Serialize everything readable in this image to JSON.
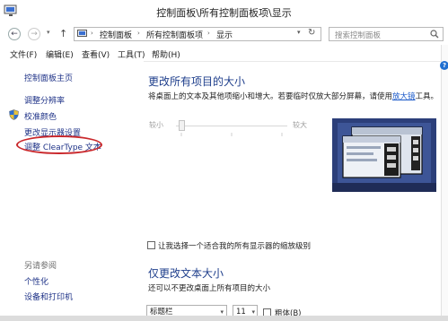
{
  "window": {
    "title": "控制面板\\所有控制面板项\\显示",
    "controls": {
      "minimize": "—",
      "maximize": "☐",
      "close": "✕"
    }
  },
  "nav": {
    "back": "←",
    "forward": "→",
    "up": "↑",
    "breadcrumbs": [
      "控制面板",
      "所有控制面板项",
      "显示"
    ],
    "separator": "›",
    "refresh": "↻",
    "search_placeholder": "搜索控制面板"
  },
  "menu": {
    "items": [
      "文件(F)",
      "编辑(E)",
      "查看(V)",
      "工具(T)",
      "帮助(H)"
    ]
  },
  "sidebar": {
    "home": "控制面板主页",
    "links": [
      "调整分辨率",
      "校准颜色",
      "更改显示器设置",
      "调整 ClearType 文本"
    ],
    "see_also_title": "另请参阅",
    "see_also": [
      "个性化",
      "设备和打印机"
    ]
  },
  "main": {
    "heading": "更改所有项目的大小",
    "desc_prefix": "将桌面上的文本及其他项缩小和增大。若要临时仅放大部分屏幕，请使用",
    "desc_link": "放大镜",
    "desc_suffix": "工具。",
    "slider_small": "较小",
    "slider_large": "较大",
    "slider_level": 0.0,
    "checkbox_label": "让我选择一个适合我的所有显示器的缩放级别",
    "checkbox_checked": false,
    "heading2": "仅更改文本大小",
    "desc2": "还可以不更改桌面上所有项目的大小",
    "dropdown_value": "标题栏",
    "size_value": "11",
    "bold_label": "粗体(B)",
    "bold_checked": false
  },
  "help_icon": "?",
  "colors": {
    "heading": "#1f3f8c",
    "link": "#1e3287",
    "ellipse": "#c9272b",
    "preview_bg": "#2c3f7a"
  }
}
